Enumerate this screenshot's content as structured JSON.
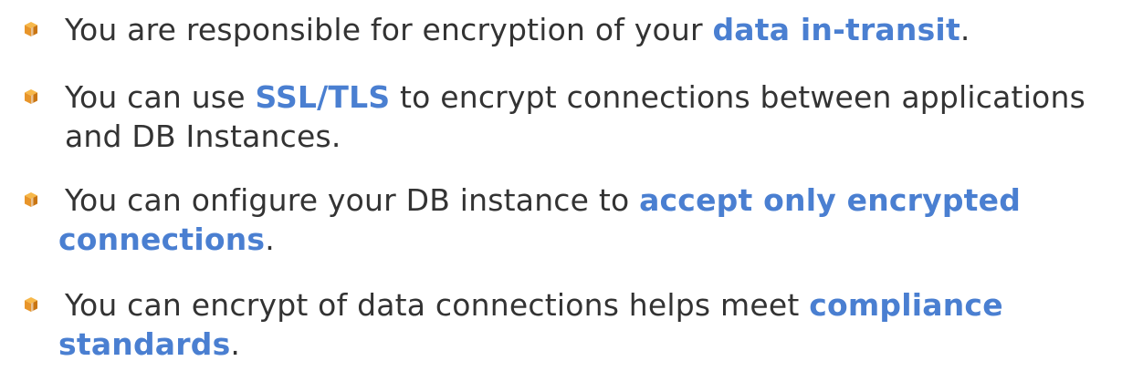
{
  "slide": {
    "accent_color": "#4a7fd1",
    "bullet_icon": "orange-cube-icon",
    "bullet_color": "#f0a020",
    "bullets": [
      {
        "line1_prefix": "You are responsible for encryption of your ",
        "highlight1": "data in-transit",
        "line1_suffix": "."
      },
      {
        "line1_prefix": "You can use ",
        "highlight1": "SSL/TLS",
        "line1_suffix": " to encrypt connections between applications",
        "line2_text": "and DB Instances."
      },
      {
        "line1_prefix": "You can onfigure your DB instance to ",
        "highlight1": "accept only encrypted",
        "line2_highlight": "connections",
        "line2_suffix": "."
      },
      {
        "line1_prefix": "You can encrypt of data connections helps meet ",
        "highlight1": "compliance",
        "line2_highlight": "standards",
        "line2_suffix": "."
      }
    ]
  }
}
